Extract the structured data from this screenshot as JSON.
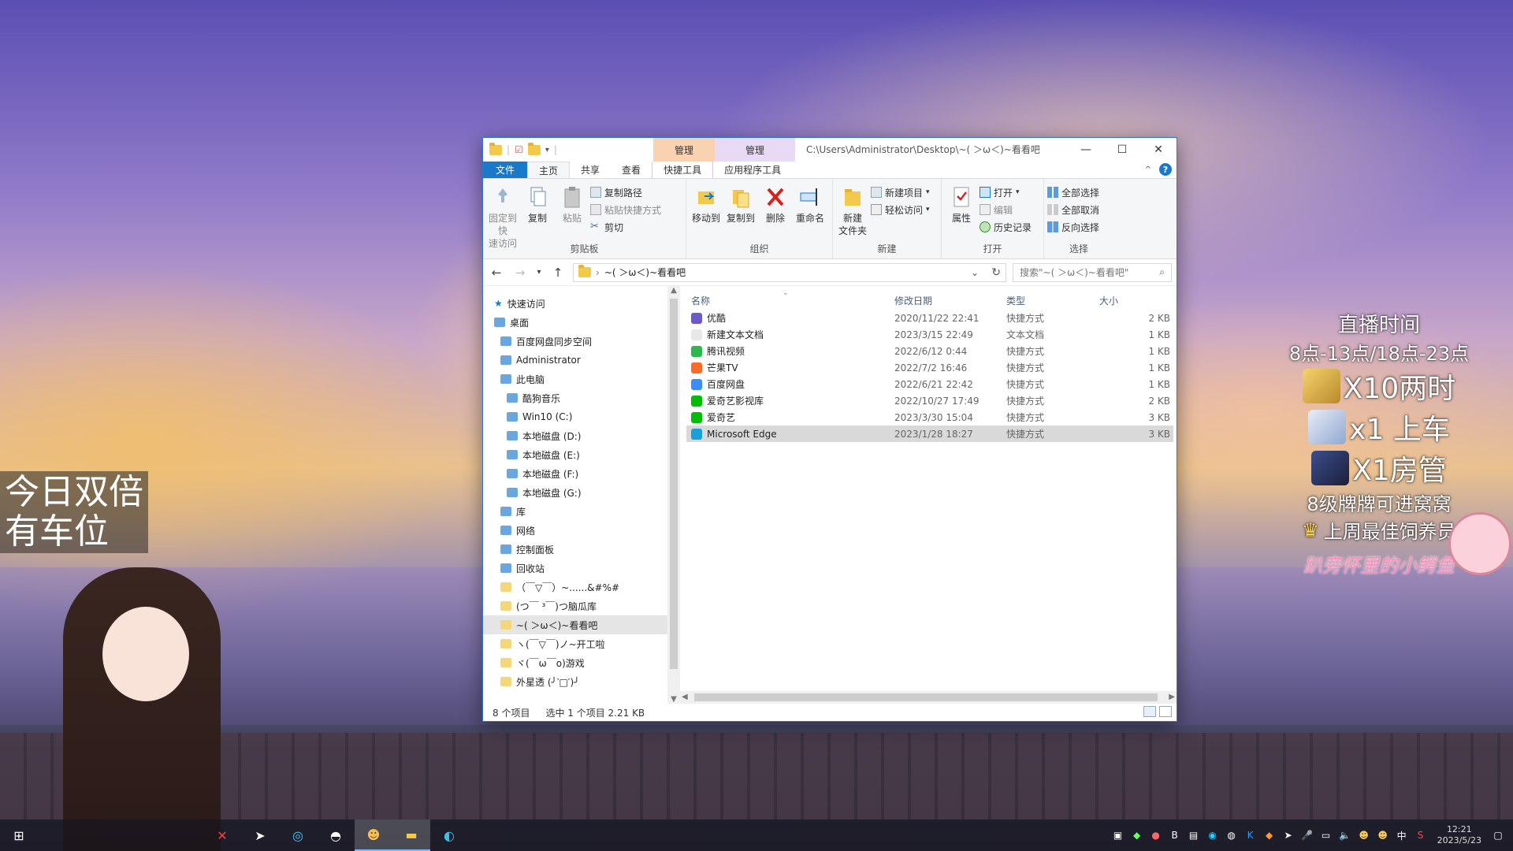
{
  "window": {
    "contextual_tabs": [
      "管理",
      "管理"
    ],
    "path_title": "C:\\Users\\Administrator\\Desktop\\~( ＞ω＜)~看看吧",
    "minimize": "—",
    "maximize": "☐",
    "close": "✕"
  },
  "tabs": {
    "file": "文件",
    "home": "主页",
    "share": "共享",
    "view": "查看",
    "shortcut_tools": "快捷工具",
    "app_tools": "应用程序工具"
  },
  "ribbon": {
    "clipboard": {
      "name": "剪贴板",
      "pin": "固定到快\n速访问",
      "copy": "复制",
      "paste": "粘贴",
      "copy_path": "复制路径",
      "paste_shortcut": "粘贴快捷方式",
      "cut": "剪切"
    },
    "organize": {
      "name": "组织",
      "move_to": "移动到",
      "copy_to": "复制到",
      "delete": "删除",
      "rename": "重命名"
    },
    "new": {
      "name": "新建",
      "new_folder": "新建\n文件夹",
      "new_item": "新建项目",
      "easy_access": "轻松访问"
    },
    "open": {
      "name": "打开",
      "properties": "属性",
      "open": "打开",
      "edit": "编辑",
      "history": "历史记录"
    },
    "select": {
      "name": "选择",
      "select_all": "全部选择",
      "select_none": "全部取消",
      "invert": "反向选择"
    }
  },
  "address": {
    "path": "~( ＞ω＜)~看看吧",
    "search_placeholder": "搜索\"~( ＞ω＜)~看看吧\""
  },
  "nav": [
    {
      "label": "快速访问",
      "level": 0
    },
    {
      "label": "桌面",
      "level": 0
    },
    {
      "label": "百度网盘同步空间",
      "level": 1
    },
    {
      "label": "Administrator",
      "level": 1
    },
    {
      "label": "此电脑",
      "level": 1
    },
    {
      "label": "酷狗音乐",
      "level": 2
    },
    {
      "label": "Win10 (C:)",
      "level": 2
    },
    {
      "label": "本地磁盘 (D:)",
      "level": 2
    },
    {
      "label": "本地磁盘 (E:)",
      "level": 2
    },
    {
      "label": "本地磁盘 (F:)",
      "level": 2
    },
    {
      "label": "本地磁盘 (G:)",
      "level": 2
    },
    {
      "label": "库",
      "level": 1
    },
    {
      "label": "网络",
      "level": 1
    },
    {
      "label": "控制面板",
      "level": 1
    },
    {
      "label": "回收站",
      "level": 1
    },
    {
      "label": "（￣▽￣）~......&#%#",
      "level": 1
    },
    {
      "label": "(つ￣ ³￣)つ脑瓜库",
      "level": 1
    },
    {
      "label": "~( ＞ω＜)~看看吧",
      "level": 1
    },
    {
      "label": "ヽ(￣▽￣)ノ~开工啦",
      "level": 1
    },
    {
      "label": "ヾ(￣ω￣o)游戏",
      "level": 1
    },
    {
      "label": "外星透     (╯‵□′)╯",
      "level": 1
    }
  ],
  "columns": {
    "name": "名称",
    "date": "修改日期",
    "type": "类型",
    "size": "大小"
  },
  "files": [
    {
      "name": "优酷",
      "date": "2020/11/22 22:41",
      "type": "快捷方式",
      "size": "2 KB",
      "color": "#6a5acd"
    },
    {
      "name": "新建文本文档",
      "date": "2023/3/15 22:49",
      "type": "文本文档",
      "size": "1 KB",
      "color": "#e8e8e8"
    },
    {
      "name": "腾讯视频",
      "date": "2022/6/12 0:44",
      "type": "快捷方式",
      "size": "1 KB",
      "color": "#2db84d"
    },
    {
      "name": "芒果TV",
      "date": "2022/7/2 16:46",
      "type": "快捷方式",
      "size": "1 KB",
      "color": "#ff6a2b"
    },
    {
      "name": "百度网盘",
      "date": "2022/6/21 22:42",
      "type": "快捷方式",
      "size": "1 KB",
      "color": "#3b8cff"
    },
    {
      "name": "爱奇艺影视库",
      "date": "2022/10/27 17:49",
      "type": "快捷方式",
      "size": "2 KB",
      "color": "#00be06"
    },
    {
      "name": "爱奇艺",
      "date": "2023/3/30 15:04",
      "type": "快捷方式",
      "size": "3 KB",
      "color": "#00be06"
    },
    {
      "name": "Microsoft Edge",
      "date": "2023/1/28 18:27",
      "type": "快捷方式",
      "size": "3 KB",
      "color": "#1aa0d8",
      "selected": true
    }
  ],
  "status": {
    "count": "8 个项目",
    "selected": "选中 1 个项目  2.21 KB"
  },
  "overlay": {
    "left_banner_1": "今日双倍",
    "left_banner_2": "有车位",
    "live_time": "直播时间",
    "live_hours": "8点-13点/18点-23点",
    "reward1": "X10两时",
    "reward2": "x1 上车",
    "reward3": "X1房管",
    "fans_level": "8级牌牌可进窝窝",
    "best_feeder": "上周最佳饲养员",
    "feeder_name": "趴旁怀里的小鳄鱼"
  },
  "tray": {
    "ime": "中",
    "time": "12:21",
    "date": "2023/5/23"
  },
  "colors": {
    "accent": "#1979ca",
    "selected_row": "#d9d9d9"
  }
}
